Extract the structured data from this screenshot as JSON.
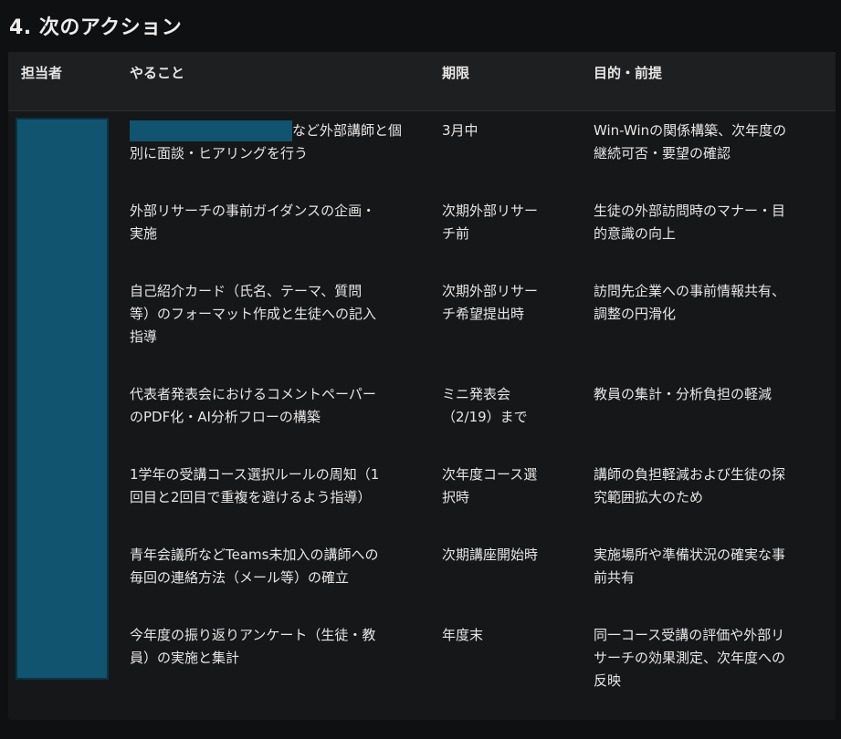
{
  "section": {
    "title": "4. 次のアクション"
  },
  "table": {
    "headers": {
      "assignee": "担当者",
      "task": "やること",
      "due": "期限",
      "purpose": "目的・前提"
    },
    "rows": [
      {
        "task_suffix": "など外部講師と個\n別に面談・ヒアリングを行う",
        "due": "3月中",
        "purpose": "Win-Winの関係構築、次年度の\n継続可否・要望の確認"
      },
      {
        "task": "外部リサーチの事前ガイダンスの企画・\n実施",
        "due": "次期外部リサー\nチ前",
        "purpose": "生徒の外部訪問時のマナー・目\n的意識の向上"
      },
      {
        "task": "自己紹介カード（氏名、テーマ、質問\n等）のフォーマット作成と生徒への記入\n指導",
        "due": "次期外部リサー\nチ希望提出時",
        "purpose": "訪問先企業への事前情報共有、\n調整の円滑化"
      },
      {
        "task": "代表者発表会におけるコメントペーパー\nのPDF化・AI分析フローの構築",
        "due": "ミニ発表会\n（2/19）まで",
        "purpose": "教員の集計・分析負担の軽減"
      },
      {
        "task": "1学年の受講コース選択ルールの周知（1\n回目と2回目で重複を避けるよう指導）",
        "due": "次年度コース選\n択時",
        "purpose": "講師の負担軽減および生徒の探\n究範囲拡大のため"
      },
      {
        "task": "青年会議所などTeams未加入の講師への\n毎回の連絡方法（メール等）の確立",
        "due": "次期講座開始時",
        "purpose": "実施場所や準備状況の確実な事\n前共有"
      },
      {
        "task": "今年度の振り返りアンケート（生徒・教\n員）の実施と集計",
        "due": "年度末",
        "purpose": "同一コース受講の評価や外部リ\nサーチの効果測定、次年度への\n反映"
      }
    ]
  },
  "colors": {
    "redaction": "#10546f",
    "background": "#0f1012",
    "header_bg": "#1e1f21"
  }
}
